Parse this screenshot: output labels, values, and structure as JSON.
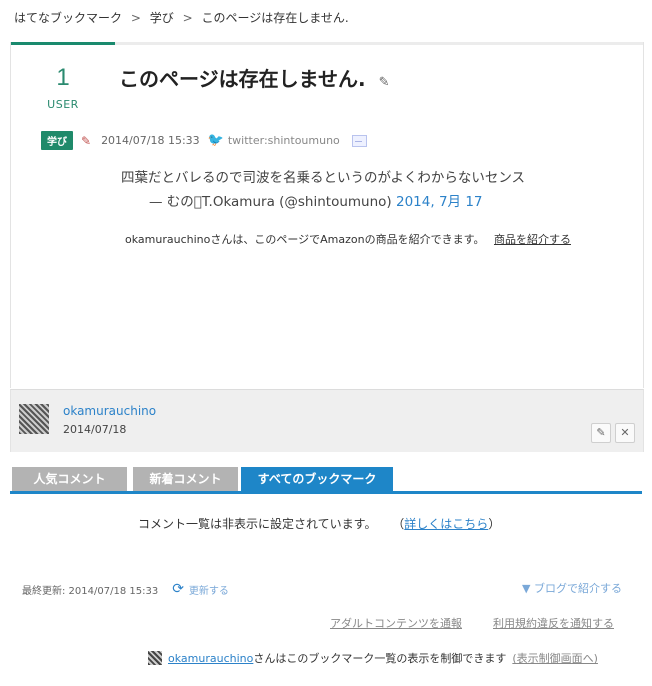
{
  "breadcrumb": {
    "site": "はてなブックマーク",
    "category": "学び",
    "current": "このページは存在しません.",
    "separator": ">"
  },
  "entry": {
    "user_count": "1",
    "user_label": "USER",
    "title": "このページは存在しません.",
    "tag": "学び",
    "datetime": "2014/07/18 15:33",
    "twitter": "twitter:shintoumuno",
    "tweet_text": "四葉だとバレるので司波を名乗るというのがよくわからないセンス",
    "tweet_by": "— むのT.Okamura (@shintoumuno)",
    "tweet_date": "2014, 7月 17",
    "amazon_text": "okamurauchinoさんは、このページでAmazonの商品を紹介できます。",
    "amazon_link": "商品を紹介する"
  },
  "bookmark": {
    "username": "okamurauchino",
    "date": "2014/07/18",
    "edit_icon": "pencil-icon",
    "close_icon": "close-icon"
  },
  "tabs": [
    {
      "label": "人気コメント"
    },
    {
      "label": "新着コメント"
    },
    {
      "label": "すべてのブックマーク"
    }
  ],
  "comments": {
    "note_text": "コメント一覧は非表示に設定されています。",
    "paren_open": "（",
    "note_link": "詳しくはこちら",
    "paren_close": "）"
  },
  "footer": {
    "last_updated": "最終更新: 2014/07/18 15:33",
    "refresh_label": "更新する",
    "blog_label": "▼ ブログで紹介する",
    "report_adult": "アダルトコンテンツを通報",
    "report_terms": "利用規約違反を通知する",
    "control_user": "okamurauchino",
    "control_text": "さんはこのブックマーク一覧の表示を制御できます",
    "control_link": "(表示制御画面へ)"
  },
  "colors": {
    "accent_green": "#1f8a6a",
    "tab_active": "#1e86c8",
    "link_blue": "#2c82c9"
  }
}
